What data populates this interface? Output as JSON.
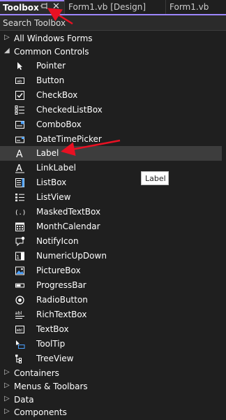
{
  "colors": {
    "accent": "#9d86ff",
    "background": "#1f1f1f",
    "arrow": "#e81123"
  },
  "tabs": {
    "active": "Toolbox",
    "others": [
      "Form1.vb [Design]",
      "Form1.vb"
    ]
  },
  "search": {
    "placeholder": "Search Toolbox"
  },
  "groups": {
    "all_windows_forms": "All Windows Forms",
    "common_controls": "Common Controls",
    "containers": "Containers",
    "menus_toolbars": "Menus & Toolbars",
    "data": "Data",
    "components": "Components"
  },
  "items": [
    {
      "label": "Pointer",
      "icon": "pointer-icon"
    },
    {
      "label": "Button",
      "icon": "button-icon"
    },
    {
      "label": "CheckBox",
      "icon": "checkbox-icon"
    },
    {
      "label": "CheckedListBox",
      "icon": "checkedlistbox-icon"
    },
    {
      "label": "ComboBox",
      "icon": "combobox-icon"
    },
    {
      "label": "DateTimePicker",
      "icon": "datetimepicker-icon"
    },
    {
      "label": "Label",
      "icon": "label-icon"
    },
    {
      "label": "LinkLabel",
      "icon": "linklabel-icon"
    },
    {
      "label": "ListBox",
      "icon": "listbox-icon"
    },
    {
      "label": "ListView",
      "icon": "listview-icon"
    },
    {
      "label": "MaskedTextBox",
      "icon": "maskedtextbox-icon"
    },
    {
      "label": "MonthCalendar",
      "icon": "monthcalendar-icon"
    },
    {
      "label": "NotifyIcon",
      "icon": "notifyicon-icon"
    },
    {
      "label": "NumericUpDown",
      "icon": "numericupdown-icon"
    },
    {
      "label": "PictureBox",
      "icon": "picturebox-icon"
    },
    {
      "label": "ProgressBar",
      "icon": "progressbar-icon"
    },
    {
      "label": "RadioButton",
      "icon": "radiobutton-icon"
    },
    {
      "label": "RichTextBox",
      "icon": "richtextbox-icon"
    },
    {
      "label": "TextBox",
      "icon": "textbox-icon"
    },
    {
      "label": "ToolTip",
      "icon": "tooltip-icon"
    },
    {
      "label": "TreeView",
      "icon": "treeview-icon"
    }
  ],
  "tooltip": "Label"
}
